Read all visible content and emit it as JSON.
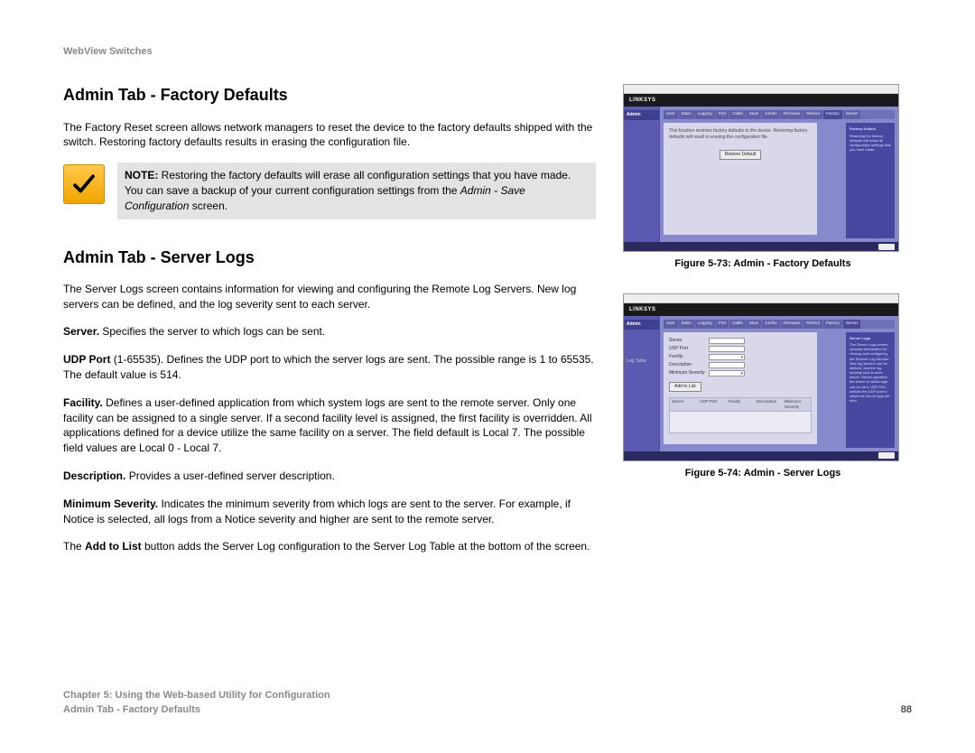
{
  "doc_header": "WebView Switches",
  "sections": {
    "factory_defaults": {
      "heading": "Admin Tab - Factory Defaults",
      "intro": "The Factory Reset screen allows network managers to reset the device to the factory defaults shipped with the switch. Restoring factory defaults results in erasing the configuration file.",
      "note_label": "NOTE:",
      "note_text_1": " Restoring the factory defaults will erase all configuration settings that you have made. You can save a backup of your current configuration settings from the ",
      "note_italic": "Admin - Save Configuration",
      "note_text_2": " screen."
    },
    "server_logs": {
      "heading": "Admin Tab - Server Logs",
      "intro": "The Server Logs screen contains information for viewing and configuring the Remote Log Servers. New log servers can be defined, and the log severity sent to each server.",
      "defs": {
        "server": {
          "term": "Server.",
          "desc": " Specifies the server to which logs can be sent."
        },
        "udp": {
          "term": "UDP Port",
          "desc": " (1-65535). Defines the UDP port to which the server logs are sent. The possible range is 1 to 65535. The default value is 514."
        },
        "facility": {
          "term": "Facility.",
          "desc": " Defines a user-defined application from which system logs are sent to the remote server. Only one facility can be assigned to a single server. If a second facility level is assigned, the first facility is overridden. All applications defined for a device utilize the same facility on a server. The field default is Local 7. The possible field values are Local 0 - Local 7."
        },
        "description": {
          "term": "Description.",
          "desc": " Provides a user-defined server description."
        },
        "severity": {
          "term": "Minimum Severity.",
          "desc": " Indicates the minimum severity from which logs are sent to the server. For example, if Notice is selected, all logs from a Notice severity and higher are sent to the remote server."
        }
      },
      "footer_line_pre": "The ",
      "footer_line_bold": "Add to List",
      "footer_line_post": " button adds the Server Log configuration to the Server Log Table at the bottom of the screen."
    }
  },
  "figures": {
    "f73": {
      "caption": "Figure 5-73: Admin - Factory Defaults",
      "brand": "LINKSYS",
      "side_label": "Admin",
      "panel_text": "This function restores factory defaults to the device. Restoring factory defaults will result in erasing the configuration file.",
      "button": "Restore Default",
      "help_title": "Factory Default"
    },
    "f74": {
      "caption": "Figure 5-74: Admin - Server Logs",
      "brand": "LINKSYS",
      "side_label": "Admin",
      "side_sub": "Log Table",
      "fields": {
        "server": "Server",
        "udp": "UDP Port",
        "facility": "Facility",
        "desc": "Description",
        "sev": "Minimum Severity"
      },
      "button": "Add to List",
      "table_headers": [
        "Server",
        "UDP Port",
        "Facility",
        "Description",
        "Minimum Severity"
      ],
      "help_title": "Server Logs"
    }
  },
  "footer": {
    "line1": "Chapter 5: Using the Web-based Utility for Configuration",
    "line2": "Admin Tab - Factory Defaults",
    "page": "88"
  }
}
